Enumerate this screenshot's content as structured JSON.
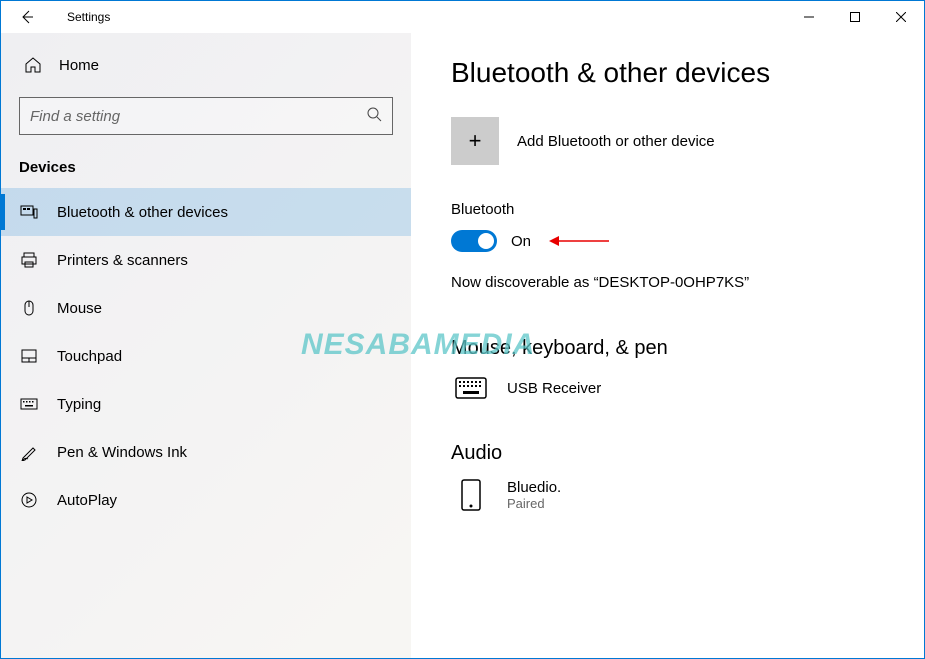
{
  "window": {
    "title": "Settings"
  },
  "sidebar": {
    "home_label": "Home",
    "search_placeholder": "Find a setting",
    "category": "Devices",
    "items": [
      {
        "label": "Bluetooth & other devices",
        "active": true
      },
      {
        "label": "Printers & scanners",
        "active": false
      },
      {
        "label": "Mouse",
        "active": false
      },
      {
        "label": "Touchpad",
        "active": false
      },
      {
        "label": "Typing",
        "active": false
      },
      {
        "label": "Pen & Windows Ink",
        "active": false
      },
      {
        "label": "AutoPlay",
        "active": false
      }
    ]
  },
  "main": {
    "title": "Bluetooth & other devices",
    "add_device_label": "Add Bluetooth or other device",
    "bluetooth_label": "Bluetooth",
    "toggle_state": "On",
    "discoverable_text": "Now discoverable as “DESKTOP-0OHP7KS”",
    "sections": {
      "mouse": {
        "title": "Mouse, keyboard, & pen",
        "devices": [
          {
            "name": "USB Receiver",
            "status": ""
          }
        ]
      },
      "audio": {
        "title": "Audio",
        "devices": [
          {
            "name": "Bluedio.",
            "status": "Paired"
          }
        ]
      }
    }
  },
  "watermark": "NESABAMEDIA"
}
